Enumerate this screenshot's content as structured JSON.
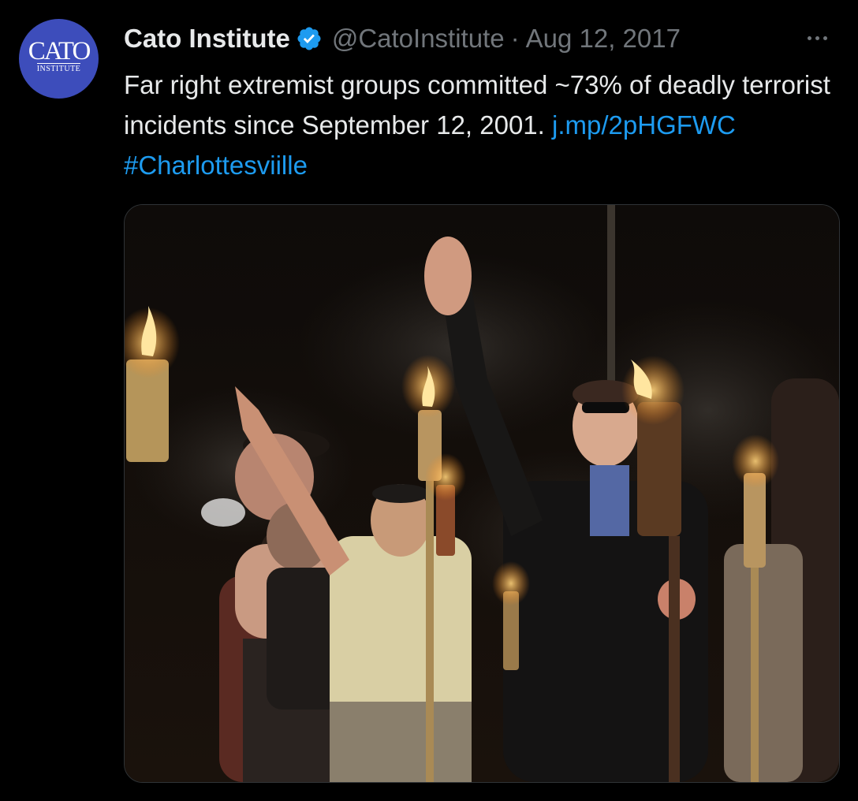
{
  "tweet": {
    "author": {
      "name": "Cato Institute",
      "handle": "@CatoInstitute",
      "avatar_logo": "CATO",
      "avatar_sub": "INSTITUTE",
      "verified_icon": "verified-badge-icon"
    },
    "separator": "·",
    "date": "Aug 12, 2017",
    "text": {
      "body": "Far right extremist groups committed ~73% of deadly terrorist incidents since September 12, 2001. ",
      "link": "j.mp/2pHGFWC",
      "space": " ",
      "hashtag": "#Charlottesviille"
    },
    "more_icon": "more-horizontal-icon",
    "media": {
      "kind": "photo",
      "subject": "night torch rally"
    }
  },
  "colors": {
    "background": "#000000",
    "text": "#e7e9ea",
    "secondary": "#71767b",
    "link": "#1d9bf0",
    "avatar": "#3d4dbb",
    "border": "#2f3336"
  }
}
